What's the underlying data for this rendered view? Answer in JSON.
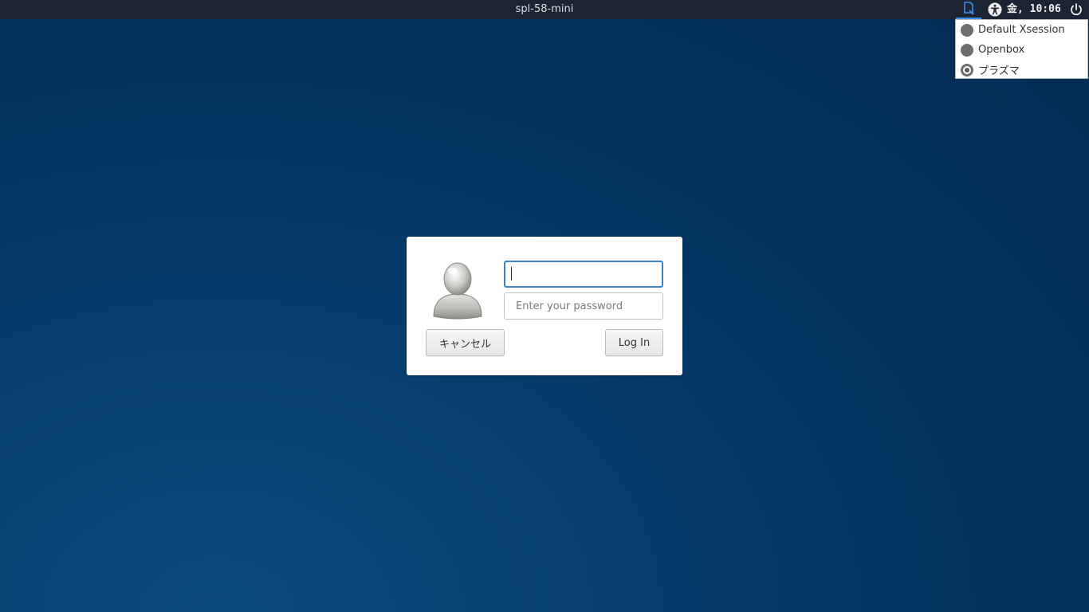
{
  "panel": {
    "title": "spl-58-mini",
    "clock": "金, 10:06",
    "session_icon": "session-icon",
    "a11y_icon": "accessibility-icon",
    "power_icon": "power-icon",
    "accent_color": "#3d8ee9"
  },
  "session_menu": {
    "items": [
      {
        "label": "Default Xsession",
        "selected": false
      },
      {
        "label": "Openbox",
        "selected": false
      },
      {
        "label": "プラズマ",
        "selected": true
      }
    ]
  },
  "login": {
    "username_value": "",
    "password_placeholder": "Enter your password",
    "cancel_label": "キャンセル",
    "login_label": "Log In"
  }
}
